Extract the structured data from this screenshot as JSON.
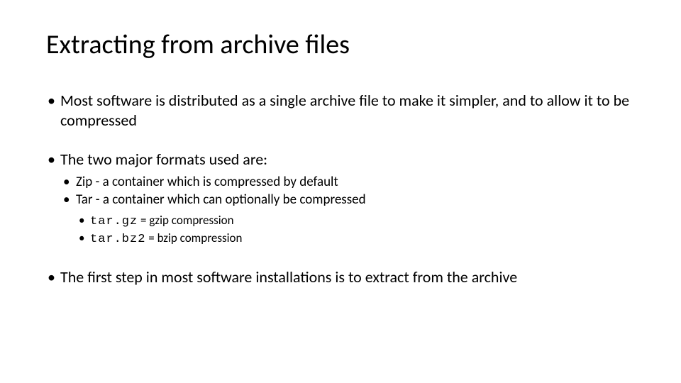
{
  "title": "Extracting from archive files",
  "bullets": {
    "b1": "Most software is distributed as a single archive file to make it simpler, and to allow it to be compressed",
    "b2": "The two major formats used are:",
    "b2_sub": {
      "zip": "Zip - a container which is compressed by default",
      "tar": "Tar - a container which can optionally be compressed",
      "ext1_code": "tar.gz",
      "ext1_desc": " = gzip compression",
      "ext2_code": "tar.bz2",
      "ext2_desc": " = bzip compression"
    },
    "b3": "The first step in most software installations is to extract from the archive"
  }
}
